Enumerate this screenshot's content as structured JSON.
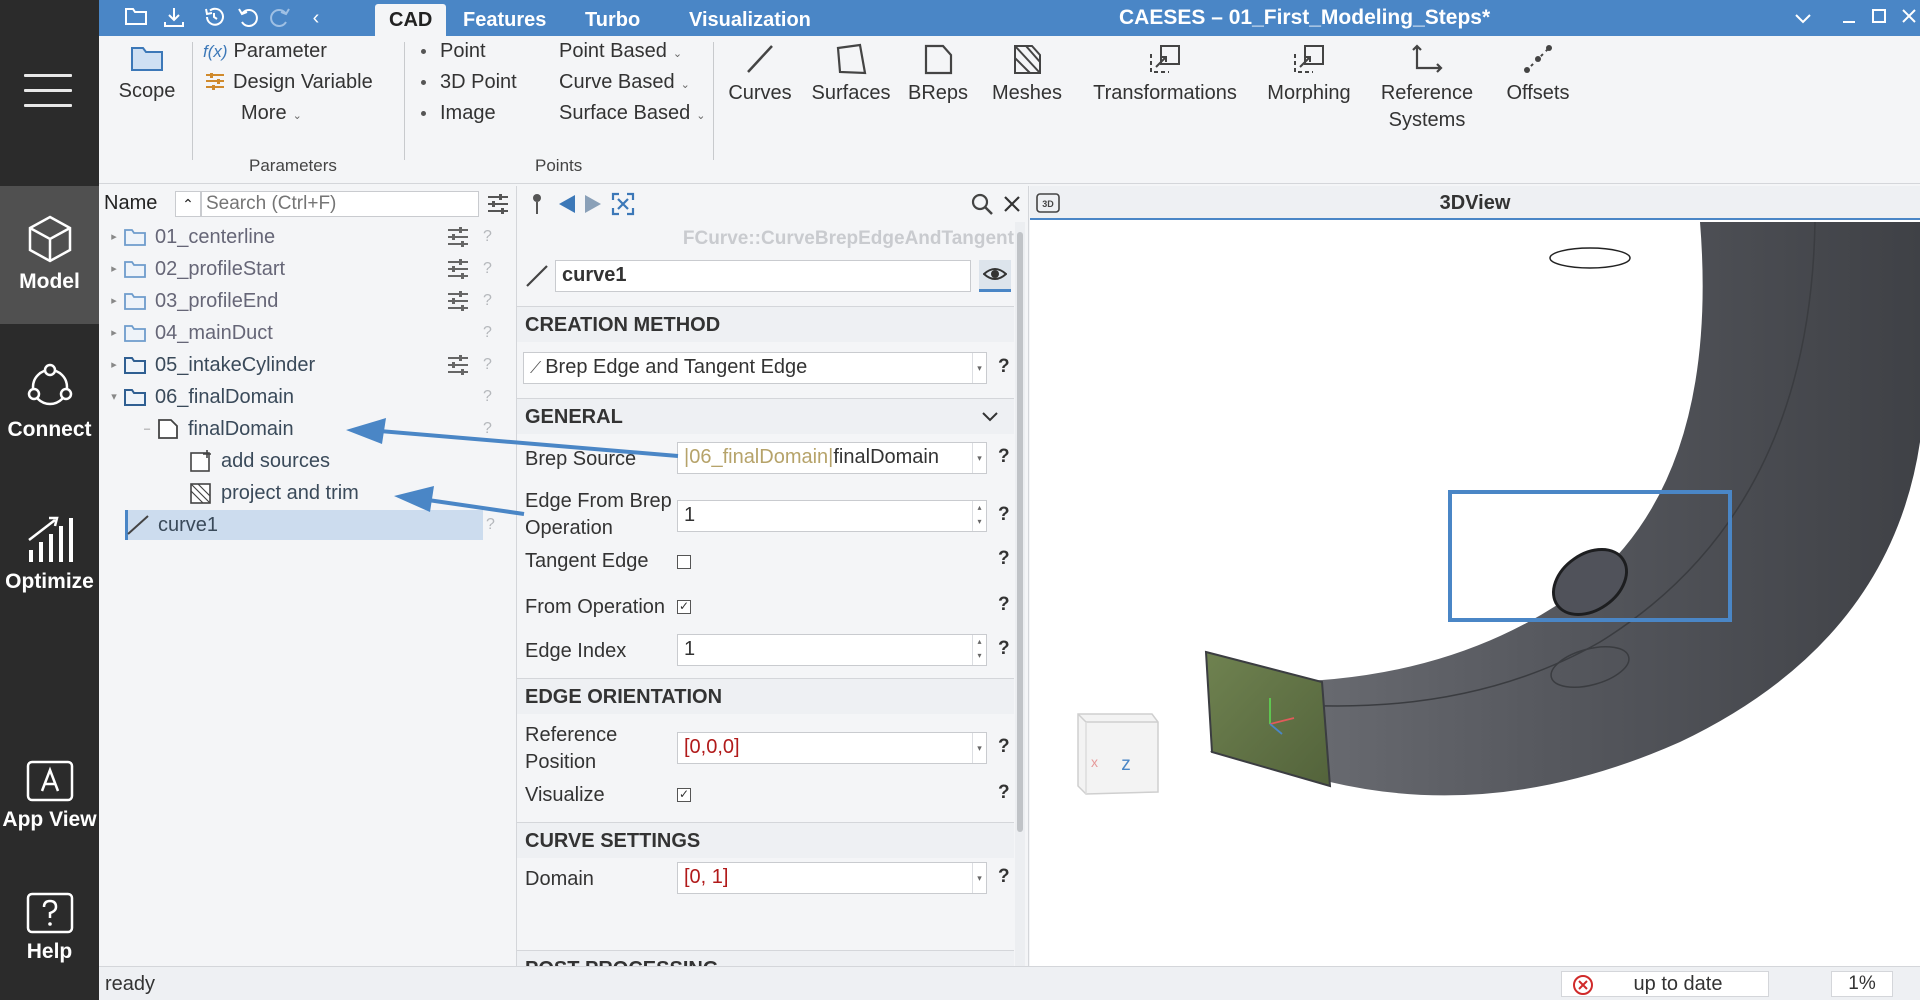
{
  "app": {
    "title": "CAESES – 01_First_Modeling_Steps*"
  },
  "sidebar": {
    "items": [
      {
        "label": "Model",
        "active": true
      },
      {
        "label": "Connect",
        "active": false
      },
      {
        "label": "Optimize",
        "active": false
      },
      {
        "label": "App View",
        "active": false
      },
      {
        "label": "Help",
        "active": false
      }
    ]
  },
  "tabs": [
    {
      "label": "CAD",
      "active": true
    },
    {
      "label": "Features",
      "active": false
    },
    {
      "label": "Turbo",
      "active": false
    },
    {
      "label": "Visualization",
      "active": false
    }
  ],
  "ribbon": {
    "scope": "Scope",
    "parameter": "Parameter",
    "fx": "f(x)",
    "design_variable": "Design Variable",
    "more": "More",
    "group_parameters": "Parameters",
    "point": "Point",
    "point_3d": "3D Point",
    "image": "Image",
    "point_based": "Point Based",
    "curve_based": "Curve Based",
    "surface_based": "Surface Based",
    "group_points": "Points",
    "curves": "Curves",
    "surfaces": "Surfaces",
    "breps": "BReps",
    "meshes": "Meshes",
    "transformations": "Transformations",
    "morphing": "Morphing",
    "reference_systems_1": "Reference",
    "reference_systems_2": "Systems",
    "offsets": "Offsets"
  },
  "tree": {
    "header_name": "Name",
    "search_placeholder": "Search (Ctrl+F)",
    "rows": [
      {
        "label": "01_centerline"
      },
      {
        "label": "02_profileStart"
      },
      {
        "label": "03_profileEnd"
      },
      {
        "label": "04_mainDuct"
      },
      {
        "label": "05_intakeCylinder"
      },
      {
        "label": "06_finalDomain"
      },
      {
        "label": "finalDomain"
      },
      {
        "label": "add sources"
      },
      {
        "label": "project and trim"
      },
      {
        "label": "curve1"
      }
    ],
    "help": "?"
  },
  "properties": {
    "type": "FCurve::CurveBrepEdgeAndTangent",
    "name": "curve1",
    "creation_method": {
      "header": "CREATION METHOD",
      "value": "Brep Edge and Tangent Edge"
    },
    "general": {
      "header": "GENERAL",
      "brep_source_label": "Brep Source",
      "brep_source_path": "|06_finalDomain|",
      "brep_source_value": "finalDomain",
      "edge_from_brep_label_1": "Edge From Brep",
      "edge_from_brep_label_2": "Operation",
      "edge_from_brep_value": "1",
      "tangent_edge_label": "Tangent Edge",
      "tangent_edge_checked": false,
      "from_operation_label": "From Operation",
      "from_operation_checked": true,
      "edge_index_label": "Edge Index",
      "edge_index_value": "1"
    },
    "edge_orientation": {
      "header": "EDGE ORIENTATION",
      "reference_position_label_1": "Reference",
      "reference_position_label_2": "Position",
      "reference_position_value": "[0,0,0]",
      "visualize_label": "Visualize",
      "visualize_checked": true
    },
    "curve_settings": {
      "header": "CURVE SETTINGS",
      "domain_label": "Domain",
      "domain_value": "[0, 1]"
    },
    "post_processing": {
      "header": "POST PROCESSING"
    },
    "help": "?"
  },
  "view3d": {
    "title": "3DView",
    "badge": "3D",
    "cube_z": "z",
    "cube_x": "x"
  },
  "status": {
    "text": "ready",
    "state": "up to date",
    "percent": "1%"
  },
  "colors": {
    "accent": "#4a86c6",
    "sidebar": "#2b2b2b",
    "duct": "#595b61",
    "face": "#6e7d4f"
  }
}
